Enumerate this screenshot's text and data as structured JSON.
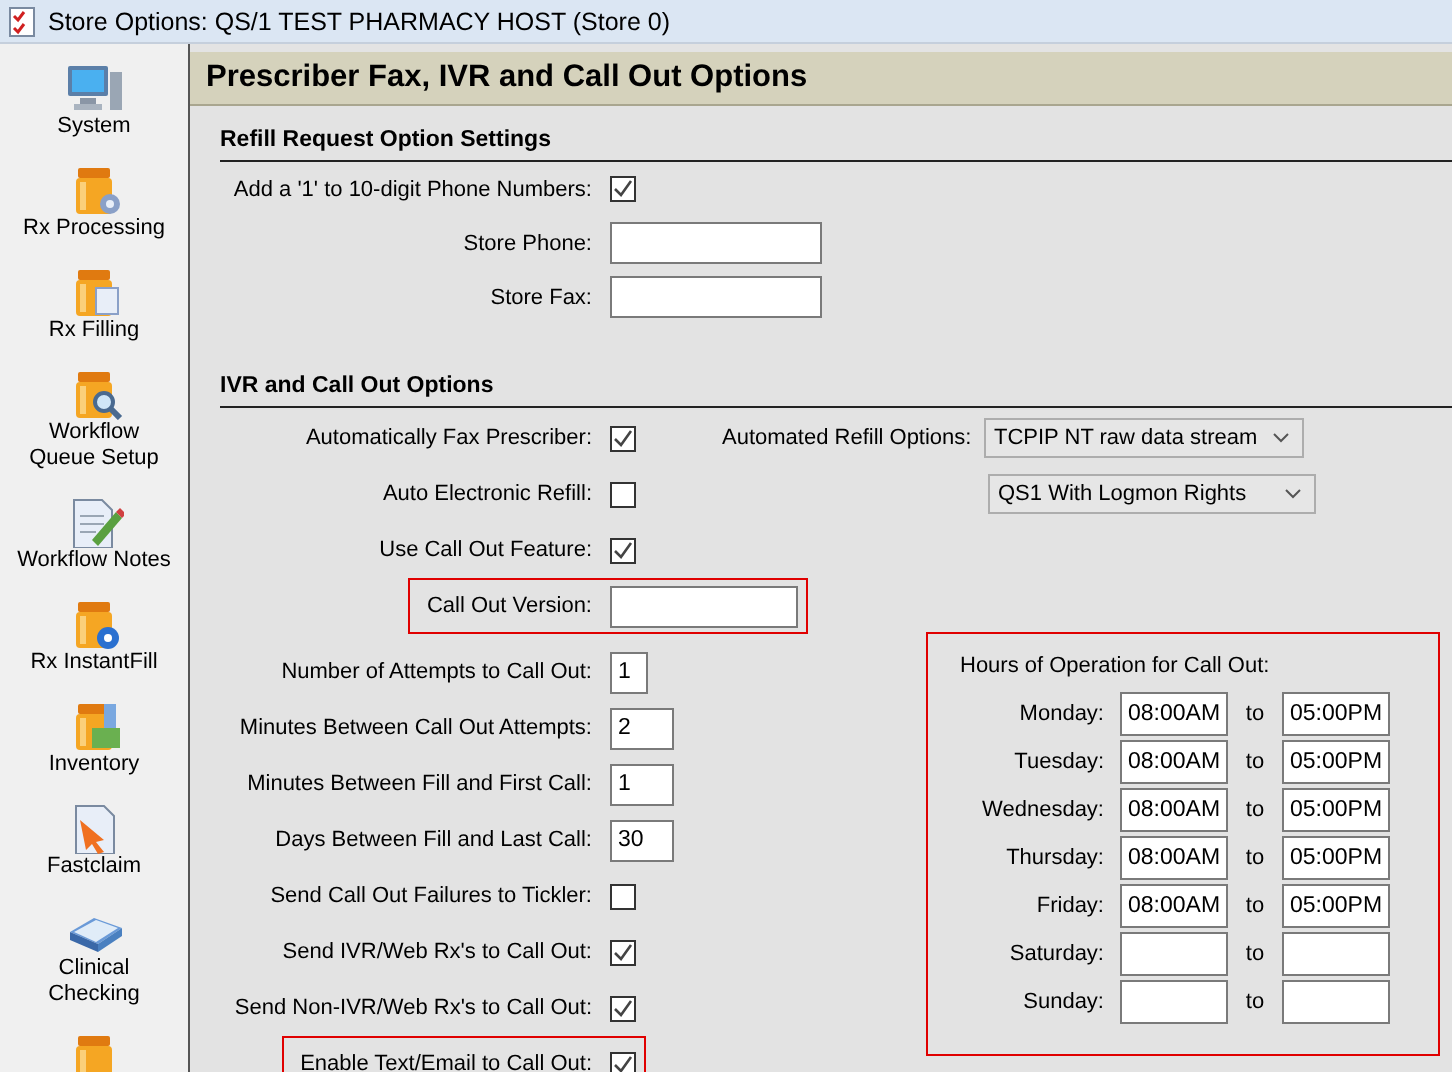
{
  "window": {
    "title": "Store Options: QS/1 TEST PHARMACY HOST (Store 0)"
  },
  "sidebar": {
    "items": [
      {
        "label": "System"
      },
      {
        "label": "Rx Processing"
      },
      {
        "label": "Rx Filling"
      },
      {
        "label": "Workflow Queue Setup"
      },
      {
        "label": "Workflow Notes"
      },
      {
        "label": "Rx InstantFill"
      },
      {
        "label": "Inventory"
      },
      {
        "label": "Fastclaim"
      },
      {
        "label": "Clinical Checking"
      }
    ]
  },
  "page": {
    "title": "Prescriber Fax, IVR and Call Out Options"
  },
  "sections": [
    {
      "heading": "Refill Request Option Settings",
      "rows": [
        {
          "kind": "checkbox",
          "label": "Add a '1' to 10-digit Phone Numbers:",
          "checked": true,
          "highlighted": false
        },
        {
          "kind": "text",
          "label": "Store Phone:",
          "highlighted": false
        },
        {
          "kind": "text",
          "label": "Store Fax:",
          "highlighted": false
        }
      ]
    },
    {
      "heading": "IVR and Call Out Options",
      "rows": [
        {
          "kind": "checkbox",
          "label": "Automatically Fax Prescriber:",
          "checked": true,
          "highlighted": false
        },
        {
          "kind": "checkbox",
          "label": "Auto Electronic Refill:",
          "checked": false,
          "highlighted": false
        },
        {
          "kind": "checkbox",
          "label": "Use Call Out Feature:",
          "checked": true,
          "highlighted": false
        },
        {
          "kind": "version",
          "label": "Call Out Version:",
          "highlighted": true
        },
        {
          "kind": "digit",
          "label": "Number of Attempts to Call Out:",
          "value": "1",
          "highlighted": false
        },
        {
          "kind": "number",
          "label": "Minutes Between Call Out Attempts:",
          "value": "2",
          "highlighted": false
        },
        {
          "kind": "number",
          "label": "Minutes Between Fill and First Call:",
          "value": "1",
          "highlighted": false
        },
        {
          "kind": "number",
          "label": "Days Between Fill and Last Call:",
          "value": "30",
          "highlighted": false
        },
        {
          "kind": "checkbox",
          "label": "Send Call Out Failures to Tickler:",
          "checked": false,
          "highlighted": false
        },
        {
          "kind": "checkbox",
          "label": "Send IVR/Web Rx's to Call Out:",
          "checked": true,
          "highlighted": false
        },
        {
          "kind": "checkbox",
          "label": "Send Non-IVR/Web Rx's to Call Out:",
          "checked": true,
          "highlighted": false
        },
        {
          "kind": "checkbox",
          "label": "Enable Text/Email to Call Out:",
          "checked": true,
          "highlighted": true
        }
      ],
      "automated_refill": {
        "label": "Automated Refill Options:",
        "dropdowns": [
          {
            "value": "TCPIP NT raw data stream"
          },
          {
            "value": "QS1 With Logmon Rights"
          }
        ]
      },
      "hours": {
        "title": "Hours of Operation for Call Out:",
        "highlighted": true,
        "rows": [
          {
            "day": "Monday:",
            "start": "08:00AM",
            "to": "to",
            "end": "05:00PM"
          },
          {
            "day": "Tuesday:",
            "start": "08:00AM",
            "to": "to",
            "end": "05:00PM"
          },
          {
            "day": "Wednesday:",
            "start": "08:00AM",
            "to": "to",
            "end": "05:00PM"
          },
          {
            "day": "Thursday:",
            "start": "08:00AM",
            "to": "to",
            "end": "05:00PM"
          },
          {
            "day": "Friday:",
            "start": "08:00AM",
            "to": "to",
            "end": "05:00PM"
          },
          {
            "day": "Saturday:",
            "to": "to"
          },
          {
            "day": "Sunday:",
            "to": "to"
          }
        ]
      }
    }
  ]
}
